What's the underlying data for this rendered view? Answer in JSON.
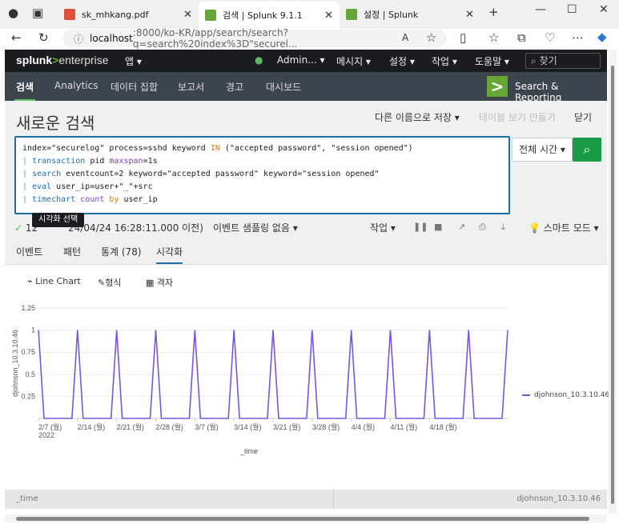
{
  "browser": {
    "tabs": [
      {
        "title": "sk_mhkang.pdf",
        "favicon_color": "#e0503a"
      },
      {
        "title": "검색 | Splunk 9.1.1",
        "favicon_color": "#65a637"
      },
      {
        "title": "설정 | Splunk",
        "favicon_color": "#65a637"
      }
    ],
    "new_tab": "+",
    "url_host": "localhost",
    "url_rest": ":8000/ko-KR/app/search/search?q=search%20index%3D\"securel..."
  },
  "splunk": {
    "logo_main": "splunk",
    "logo_gt": ">",
    "logo_ent": "enterprise",
    "topmenu": {
      "app": "앱 ▾",
      "admin": "Admin... ▾",
      "messages": "메시지 ▾",
      "settings": "설정 ▾",
      "activity": "작업 ▾",
      "help": "도움말 ▾",
      "find": "찾기"
    },
    "appnav": [
      "검색",
      "Analytics",
      "데이터 집합",
      "보고서",
      "경고",
      "대시보드"
    ],
    "app_title": "Search & Reporting",
    "page_title": "새로운 검색",
    "save_as": "다른 이름으로 저장 ▾",
    "create_table": "테이블 보기 만들기",
    "close": "닫기",
    "query_lines": [
      "index=\"securelog\" process=sshd keyword IN (\"accepted password\", \"session opened\")",
      "| transaction pid maxspan=1s",
      "| search eventcount=2 keyword=\"accepted password\" keyword=\"session opened\"",
      "| eval user_ip=user+\"_\"+src",
      "| timechart count by user_ip"
    ],
    "time_picker": "전체 시간 ▾",
    "tooltip": "시각화 선택",
    "status_count": "12",
    "status_time": "24/04/24 16:28:11.000 이전)",
    "sampling": "이벤트 샘플링 없음 ▾",
    "job": "작업 ▾",
    "smart_mode": "스마트 모드 ▾",
    "result_tabs": [
      "이벤트",
      "패턴",
      "통계 (78)",
      "시각화"
    ],
    "viz": {
      "type_label": "Line Chart",
      "format_label": "형식",
      "trellis_label": "격자"
    },
    "table_head": {
      "col1": "_time",
      "col2": "djohnson_10.3.10.46"
    }
  },
  "chart_data": {
    "type": "line",
    "xlabel": "_time",
    "ylabel": "djohnson_10.3.10.46",
    "ylim": [
      0,
      1.25
    ],
    "yticks": [
      "0.25",
      "0.5",
      "0.75",
      "1",
      "1.25"
    ],
    "xticks": [
      "2/7 (월)\n2022",
      "2/14 (월)",
      "2/21 (월)",
      "2/28 (월)",
      "3/7 (월)",
      "3/14 (월)",
      "3/21 (월)",
      "3/28 (월)",
      "4/4 (월)",
      "4/11 (월)",
      "4/18 (월)"
    ],
    "series": [
      {
        "name": "djohnson_10.3.10.46",
        "color": "#7b56db",
        "values": [
          1,
          0,
          0,
          0,
          0,
          0,
          0,
          1,
          0,
          0,
          0,
          0,
          0,
          0,
          1,
          0,
          0,
          0,
          0,
          0,
          0,
          1,
          0,
          0,
          0,
          0,
          0,
          0,
          1,
          0,
          0,
          0,
          0,
          0,
          0,
          1,
          0,
          0,
          0,
          0,
          0,
          0,
          1,
          0,
          0,
          0,
          0,
          0,
          0,
          1,
          0,
          0,
          0,
          0,
          0,
          0,
          1,
          0,
          0,
          0,
          0,
          0,
          0,
          1,
          0,
          0,
          0,
          0,
          0,
          0,
          1,
          0,
          0,
          0,
          0,
          0,
          0,
          1,
          0,
          0,
          0,
          0,
          0,
          0,
          1
        ]
      }
    ],
    "legend": "right"
  }
}
